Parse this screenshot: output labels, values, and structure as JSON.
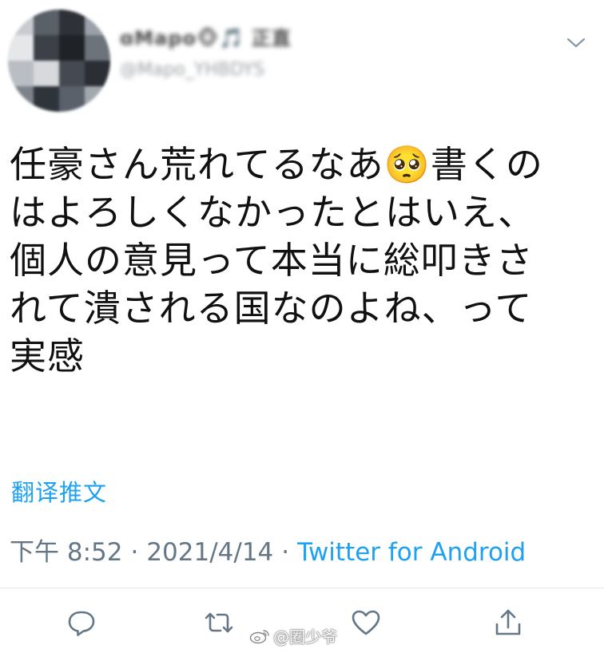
{
  "user": {
    "display_name": "ɑMapo🐵🎵 正直",
    "handle": "@Mapo_YHBDYS"
  },
  "tweet": {
    "text": "任豪さん荒れてるなあ🥺書くの\nはよろしくなかったとはいえ、\n個人の意見って本当に総叩きさ\nれて潰される国なのよね、って\n実感",
    "translate_label": "翻译推文",
    "time": "下午 8:52",
    "separator": "·",
    "date": "2021/4/14",
    "source": "Twitter for Android"
  },
  "icons": {
    "reply": "reply-icon",
    "retweet": "retweet-icon",
    "like": "heart-icon",
    "share": "share-icon",
    "more": "chevron-down-icon"
  },
  "watermark": {
    "text": "@圈少爷"
  },
  "colors": {
    "link": "#1da1f2",
    "meta": "#657786",
    "icon": "#657786",
    "text": "#111111"
  }
}
